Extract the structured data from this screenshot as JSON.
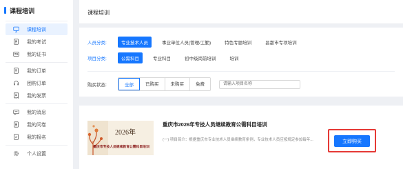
{
  "sidebar": {
    "title": "课程培训",
    "groups": [
      [
        {
          "label": "课程培训",
          "icon": "monitor-icon",
          "active": true
        },
        {
          "label": "我的考试",
          "icon": "document-icon"
        },
        {
          "label": "我的证书",
          "icon": "certificate-icon"
        }
      ],
      [
        {
          "label": "我的订单",
          "icon": "order-icon"
        },
        {
          "label": "团购订单",
          "icon": "headset-icon"
        },
        {
          "label": "我的发票",
          "icon": "invoice-icon"
        }
      ],
      [
        {
          "label": "我的消息",
          "icon": "message-icon"
        },
        {
          "label": "我的问卷",
          "icon": "survey-icon"
        },
        {
          "label": "我的报名",
          "icon": "enroll-icon"
        }
      ],
      [
        {
          "label": "个人设置",
          "icon": "gear-icon"
        }
      ]
    ]
  },
  "header": {
    "title": "课程培训"
  },
  "filters": {
    "personnel": {
      "label": "人员分类:",
      "options": [
        "专业技术人员",
        "事业单位人员(管理/工勤)",
        "特色专题培训",
        "昌都市专项培训"
      ],
      "selected": 0
    },
    "project": {
      "label": "项目分类:",
      "options": [
        "公需科目",
        "专业科目",
        "初中级岗前培训",
        "培训"
      ],
      "selected": 0
    },
    "purchase": {
      "label": "购买状态:",
      "options": [
        "全部",
        "已购买",
        "未购买",
        "免费"
      ],
      "selected": 0
    },
    "search_placeholder": "请输入项目名称"
  },
  "course": {
    "thumb_year": "2026年",
    "thumb_subtitle": "重庆市专技人员继续教育公需科目培训",
    "name": "重庆市2026年专技人员继续教育公需科目培训",
    "desc": "(一) 项目简介：根据重庆市专业技术人员继续教育条例，专业技术人员应按规定参加每年...",
    "buy_label": "立即购买"
  },
  "colors": {
    "accent": "#1677ff",
    "highlight": "#e53935"
  }
}
